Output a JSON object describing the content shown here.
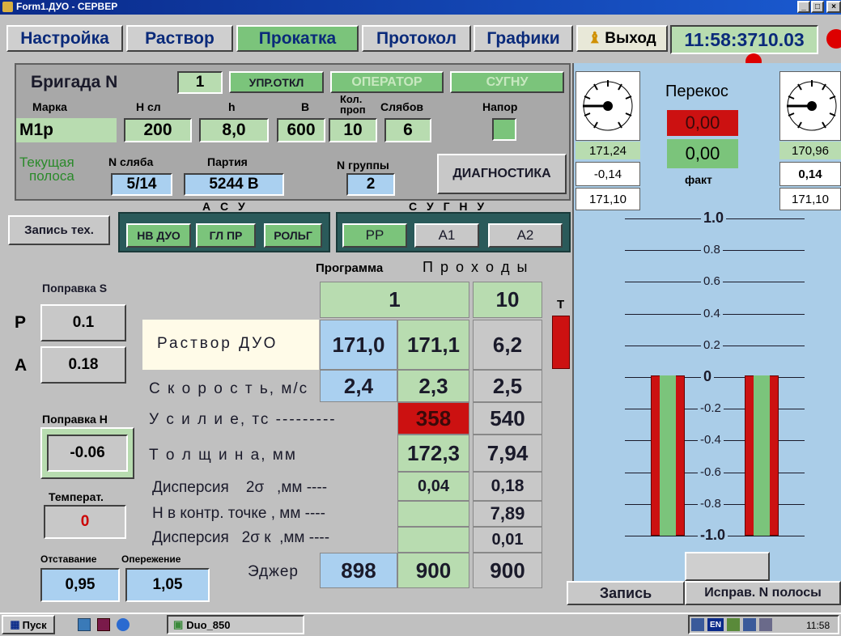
{
  "window": {
    "title": "Form1.ДУО - СЕРВЕР",
    "controls": [
      "_",
      "□",
      "×"
    ]
  },
  "menu": {
    "nastroika": "Настройка",
    "rastvor": "Раствор",
    "prokatka": "Прокатка",
    "protokol": "Протокол",
    "grafiki": "Графики",
    "vyhod": "Выход",
    "time": "11:58:3710.03"
  },
  "brigada": {
    "label": "Бригада N",
    "num": "1",
    "upr": "УПР.ОТКЛ",
    "operator": "ОПЕРАТОР",
    "sugnu": "СУГНУ"
  },
  "params": {
    "marka_l": "Марка",
    "marka": "М1р",
    "hsl_l": "Н сл",
    "hsl": "200",
    "h_l": "h",
    "h": "8,0",
    "b_l": "В",
    "b": "600",
    "kol_l1": "Кол.",
    "kol_l2": "проп",
    "kol": "10",
    "slyabov_l": "Слябов",
    "slyabov": "6",
    "napor_l": "Напор"
  },
  "tekush": {
    "label1": "Текущая",
    "label2": "полоса",
    "nsl_l": "N сляба",
    "nsl": "5/14",
    "partia_l": "Партия",
    "partia": "5244 В",
    "ngr_l": "N группы",
    "ngr": "2",
    "diag": "ДИАГНОСТИКА"
  },
  "asu": {
    "label": "А С У",
    "zapis_teh": "Запись тех.",
    "b1": "НВ ДУО",
    "b2": "ГЛ ПР",
    "b3": "РОЛЬГ"
  },
  "sugnu2": {
    "label": "С У Г Н У",
    "b1": "РР",
    "b2": "А1",
    "b3": "А2"
  },
  "left": {
    "popravka_s": "Поправка S",
    "p": "Р",
    "a": "А",
    "s1": "0.1",
    "s2": "0.18",
    "popravka_h": "Поправка Н",
    "h": "-0.06",
    "temp_l": "Температ.",
    "temp": "0",
    "otst_l": "Отставание",
    "oper_l": "Опережение",
    "otst": "0,95",
    "oper": "1,05"
  },
  "table": {
    "programma": "Программа",
    "prohody": "П р о х о д ы",
    "t": "Т",
    "pass1": "1",
    "pass10": "10",
    "rows": {
      "rastvor": {
        "label": "Раствор ДУО",
        "p": "171,0",
        "v1": "171,1",
        "v10": "6,2"
      },
      "skorost": {
        "label": "С к о р о с т ь, м/с",
        "p": "2,4",
        "v1": "2,3",
        "v10": "2,5"
      },
      "usilie": {
        "label": "У с и л и е, тс ---------",
        "v1": "358",
        "v10": "540"
      },
      "tolshina": {
        "label": "Т о л щ и н а, мм",
        "v1": "172,3",
        "v10": "7,94"
      },
      "disp": {
        "label": "Дисперсия    2σ   ,мм ----",
        "v1": "0,04",
        "v10": "0,18"
      },
      "hkontr": {
        "label": "Н в контр. точке , мм ----",
        "v10": "7,89"
      },
      "dispk": {
        "label": "Дисперсия   2σ к  ,мм ----",
        "v10": "0,01"
      },
      "edzher": {
        "label": "Эджер",
        "p": "898",
        "v1": "900",
        "v10": "900"
      }
    }
  },
  "right": {
    "perekos": "Перекос",
    "perekos_v": "0,00",
    "perekos_f": "0,00",
    "fakt": "факт",
    "l1": "171,24",
    "l2": "-0,14",
    "l3": "171,10",
    "r1": "170,96",
    "r2": "0,14",
    "r3": "171,10",
    "ticks": [
      "1.0",
      "0.8",
      "0.6",
      "0.4",
      "0.2",
      "0",
      "-0.2",
      "-0.4",
      "-0.6",
      "-0.8",
      "-1.0"
    ],
    "zapis": "Запись",
    "ispr": "Исправ. N полосы"
  },
  "taskbar": {
    "start": "Пуск",
    "app": "Duo_850",
    "lang": "EN",
    "clock": "11:58"
  },
  "colors": {
    "green": "#b8dcb0",
    "blue": "#aad0f0",
    "red": "#cc1111",
    "panel": "#aacde8"
  }
}
